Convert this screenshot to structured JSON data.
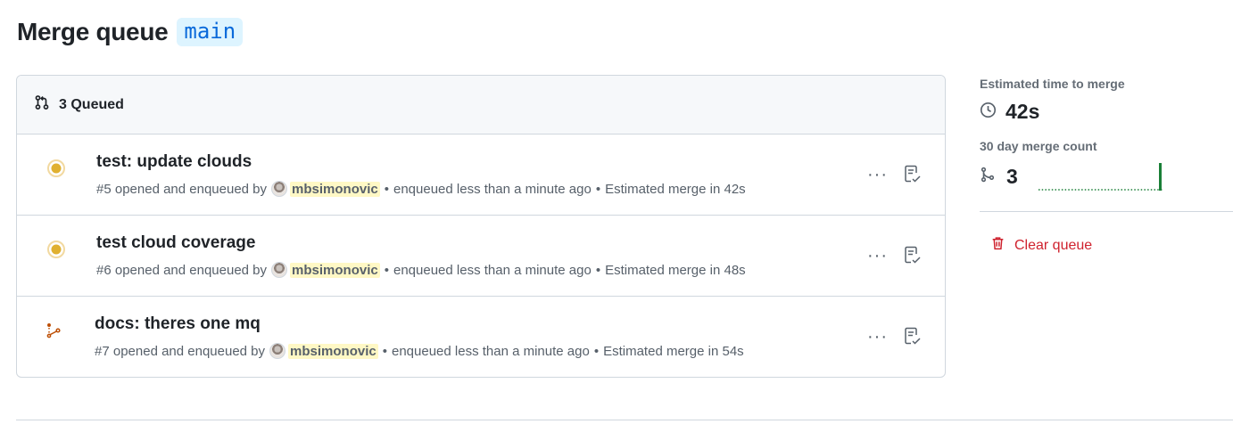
{
  "page": {
    "title": "Merge queue",
    "branch": "main"
  },
  "queue": {
    "header_label": "3 Queued",
    "rows": [
      {
        "status": "pending",
        "title": "test: update clouds",
        "number": "#5",
        "opened_text": "opened and enqueued by",
        "author": "mbsimonovic",
        "enqueued_text": "enqueued less than a minute ago",
        "estimate_text": "Estimated merge in 42s"
      },
      {
        "status": "pending",
        "title": "test cloud coverage",
        "number": "#6",
        "opened_text": "opened and enqueued by",
        "author": "mbsimonovic",
        "enqueued_text": "enqueued less than a minute ago",
        "estimate_text": "Estimated merge in 48s"
      },
      {
        "status": "queued",
        "title": "docs: theres one mq",
        "number": "#7",
        "opened_text": "opened and enqueued by",
        "author": "mbsimonovic",
        "enqueued_text": "enqueued less than a minute ago",
        "estimate_text": "Estimated merge in 54s"
      }
    ],
    "separator": "•",
    "more_label": "···"
  },
  "sidebar": {
    "estimate_label": "Estimated time to merge",
    "estimate_value": "42s",
    "count_label": "30 day merge count",
    "count_value": "3",
    "sparkline_last_fraction": 1.0,
    "clear_label": "Clear queue"
  },
  "colors": {
    "pending": "#d4a72c",
    "queued": "#bc4c00",
    "danger": "#cf222e",
    "success": "#1a7f37",
    "link": "#0969da"
  },
  "icons": {
    "header": "git-pull-request-icon",
    "pending": "dot-fill-icon",
    "queued": "git-merge-queue-icon",
    "more": "kebab-horizontal-icon",
    "checklist": "checklist-icon",
    "clock": "clock-icon",
    "merge": "git-merge-icon",
    "trash": "trash-icon"
  }
}
